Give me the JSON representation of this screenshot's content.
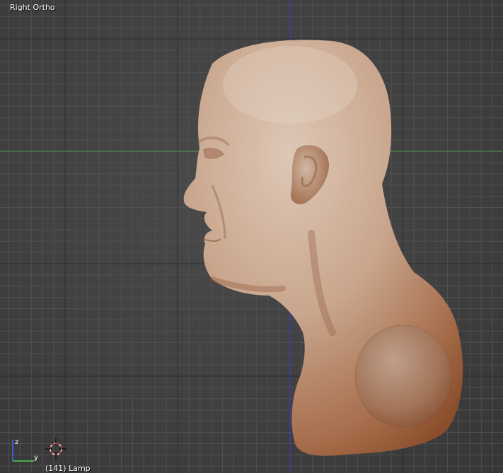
{
  "viewport": {
    "view_label": "Right Ortho",
    "object_label": "(141) Lamp",
    "grid_color": "#505050",
    "grid_major_color": "#2c2c2c",
    "x_axis_color": "#4f9a4f",
    "z_axis_color": "#3b3bd0",
    "model_color": "#c8a48a",
    "model_shadow_color": "#8a4e2c"
  },
  "gizmo": {
    "z_label": "z",
    "y_label": "y"
  }
}
